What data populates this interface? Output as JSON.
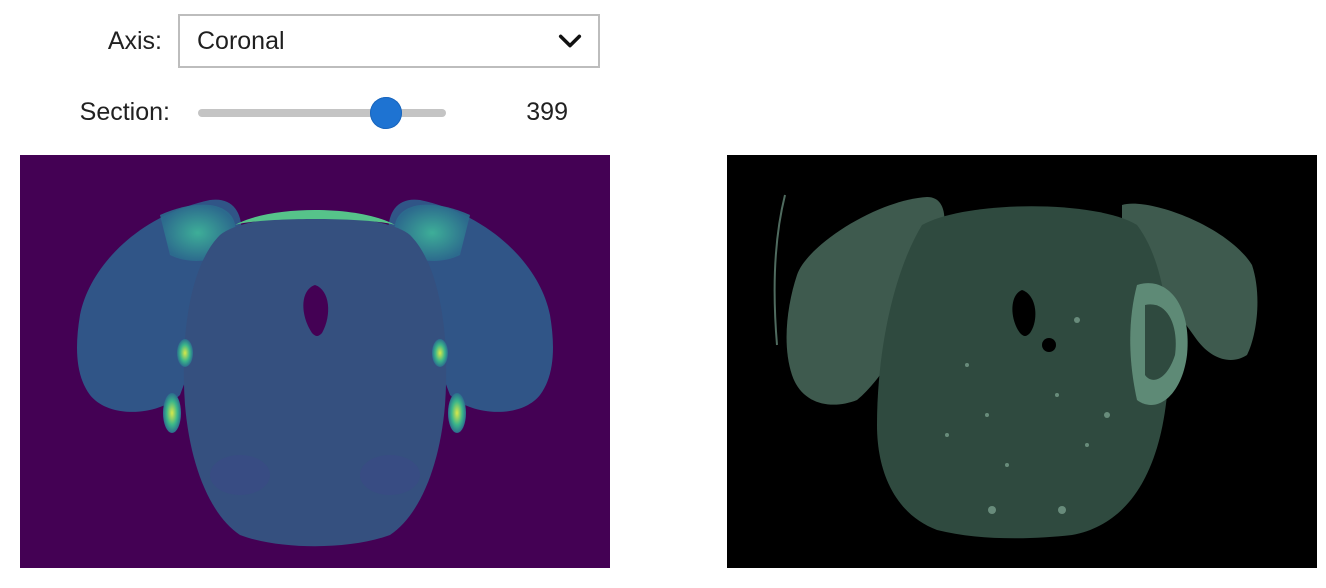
{
  "controls": {
    "axis": {
      "label": "Axis:",
      "selected": "Coronal"
    },
    "section": {
      "label": "Section:",
      "value": "399",
      "fraction": 0.76
    }
  },
  "images": {
    "left": {
      "type": "viridis-colormap brain section",
      "background": "#440154",
      "tissue": "#2f5a8a"
    },
    "right": {
      "type": "grayscale-green fluorescence brain section",
      "background": "#000000",
      "tissue": "#3c5a4c"
    }
  },
  "icons": {
    "dropdown": "chevron-down-icon"
  }
}
